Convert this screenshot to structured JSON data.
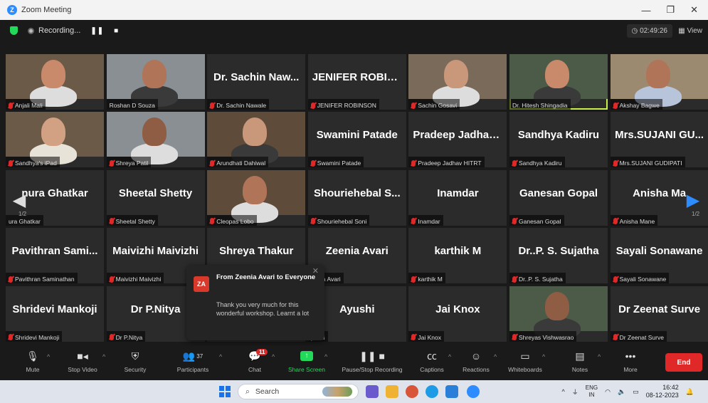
{
  "window": {
    "title": "Zoom Meeting",
    "controls": [
      "—",
      "❐",
      "✕"
    ]
  },
  "meeting": {
    "recording_label": "Recording...",
    "pause_icon": "❚❚",
    "stop_icon": "■",
    "timer": "02:49:26",
    "view_label": "View"
  },
  "navigation": {
    "left_page": "1/2",
    "right_page": "1/2"
  },
  "tiles": [
    {
      "display": "",
      "label": "Anjali Mali",
      "has_video": true,
      "muted": true
    },
    {
      "display": "",
      "label": "Roshan D Souza",
      "has_video": true,
      "muted": false
    },
    {
      "display": "Dr. Sachin Naw...",
      "label": "Dr. Sachin Nawale",
      "has_video": false,
      "muted": true
    },
    {
      "display": "JENIFER ROBIN...",
      "label": "JENIFER ROBINSON",
      "has_video": false,
      "muted": true
    },
    {
      "display": "",
      "label": "Sachin Gosavi",
      "has_video": true,
      "muted": true
    },
    {
      "display": "",
      "label": "Dr. Hitesh Shingadia",
      "has_video": true,
      "muted": false,
      "active": true
    },
    {
      "display": "",
      "label": "Akshay Bagwe",
      "has_video": true,
      "muted": true
    },
    {
      "display": "",
      "label": "Sandhya's iPad",
      "has_video": true,
      "muted": true
    },
    {
      "display": "",
      "label": "Shreya Patil",
      "has_video": true,
      "muted": true
    },
    {
      "display": "",
      "label": "Arundhati Dahiwal",
      "has_video": true,
      "muted": true
    },
    {
      "display": "Swamini Patade",
      "label": "Swamini Patade",
      "has_video": false,
      "muted": true
    },
    {
      "display": "Pradeep Jadhav...",
      "label": "Pradeep Jadhav HITRT",
      "has_video": false,
      "muted": true
    },
    {
      "display": "Sandhya Kadiru",
      "label": "Sandhya Kadiru",
      "has_video": false,
      "muted": true
    },
    {
      "display": "Mrs.SUJANI GU...",
      "label": "Mrs.SUJANI GUDIPATI",
      "has_video": false,
      "muted": true
    },
    {
      "display": "nura Ghatkar",
      "label": "ura Ghatkar",
      "has_video": false,
      "muted": false
    },
    {
      "display": "Sheetal Shetty",
      "label": "Sheetal Shetty",
      "has_video": false,
      "muted": true
    },
    {
      "display": "",
      "label": "Cleopas Lobo",
      "has_video": true,
      "muted": true
    },
    {
      "display": "Shouriehebal S...",
      "label": "Shouriehebal Soni",
      "has_video": false,
      "muted": true
    },
    {
      "display": "Inamdar",
      "label": "Inamdar",
      "has_video": false,
      "muted": true
    },
    {
      "display": "Ganesan Gopal",
      "label": "Ganesan Gopal",
      "has_video": false,
      "muted": true
    },
    {
      "display": "Anisha Ma",
      "label": "Anisha Mane",
      "has_video": false,
      "muted": true
    },
    {
      "display": "Pavithran Sami...",
      "label": "Pavithran Saminathan",
      "has_video": false,
      "muted": true
    },
    {
      "display": "Maivizhi Maivizhi",
      "label": "Maivizhi Maivizhi",
      "has_video": false,
      "muted": true
    },
    {
      "display": "Shreya Thakur",
      "label": "",
      "has_video": false,
      "muted": false
    },
    {
      "display": "Zeenia Avari",
      "label": "eenia Avari",
      "has_video": false,
      "muted": false
    },
    {
      "display": "karthik M",
      "label": "karthik M",
      "has_video": false,
      "muted": true
    },
    {
      "display": "Dr..P. S. Sujatha",
      "label": "Dr..P. S. Sujatha",
      "has_video": false,
      "muted": true
    },
    {
      "display": "Sayali Sonawane",
      "label": "Sayali Sonawane",
      "has_video": false,
      "muted": true
    },
    {
      "display": "Shridevi Mankoji",
      "label": "Shridevi Mankoji",
      "has_video": false,
      "muted": true
    },
    {
      "display": "Dr P.Nitya",
      "label": "Dr P.Nitya",
      "has_video": false,
      "muted": true
    },
    {
      "display": "",
      "label": "",
      "has_video": false,
      "muted": false
    },
    {
      "display": "Ayushi",
      "label": "yushi",
      "has_video": false,
      "muted": false
    },
    {
      "display": "Jai Knox",
      "label": "Jai Knox",
      "has_video": false,
      "muted": true
    },
    {
      "display": "",
      "label": "Shreyas Vishwasrao",
      "has_video": true,
      "muted": true
    },
    {
      "display": "Dr Zeenat Surve",
      "label": "Dr Zeenat Surve",
      "has_video": false,
      "muted": true
    }
  ],
  "chat_popup": {
    "avatar": "ZA",
    "from": "From Zeenia Avari to Everyone",
    "message": "Thank you very much for this wonderful workshop. Learnt a lot"
  },
  "toolbar": {
    "mute": "Mute",
    "stop_video": "Stop Video",
    "security": "Security",
    "participants": "Participants",
    "participants_count": "37",
    "chat": "Chat",
    "chat_badge": "11",
    "share_screen": "Share Screen",
    "pause_stop_recording": "Pause/Stop Recording",
    "captions": "Captions",
    "reactions": "Reactions",
    "whiteboards": "Whiteboards",
    "notes": "Notes",
    "more": "More",
    "end": "End"
  },
  "taskbar": {
    "search_placeholder": "Search",
    "lang1": "ENG",
    "lang2": "IN",
    "time": "16:42",
    "date": "08-12-2023"
  },
  "colors": {
    "accent": "#2d8cff",
    "end": "#e02828",
    "share": "#23d959",
    "active_border": "#c8f04b"
  }
}
